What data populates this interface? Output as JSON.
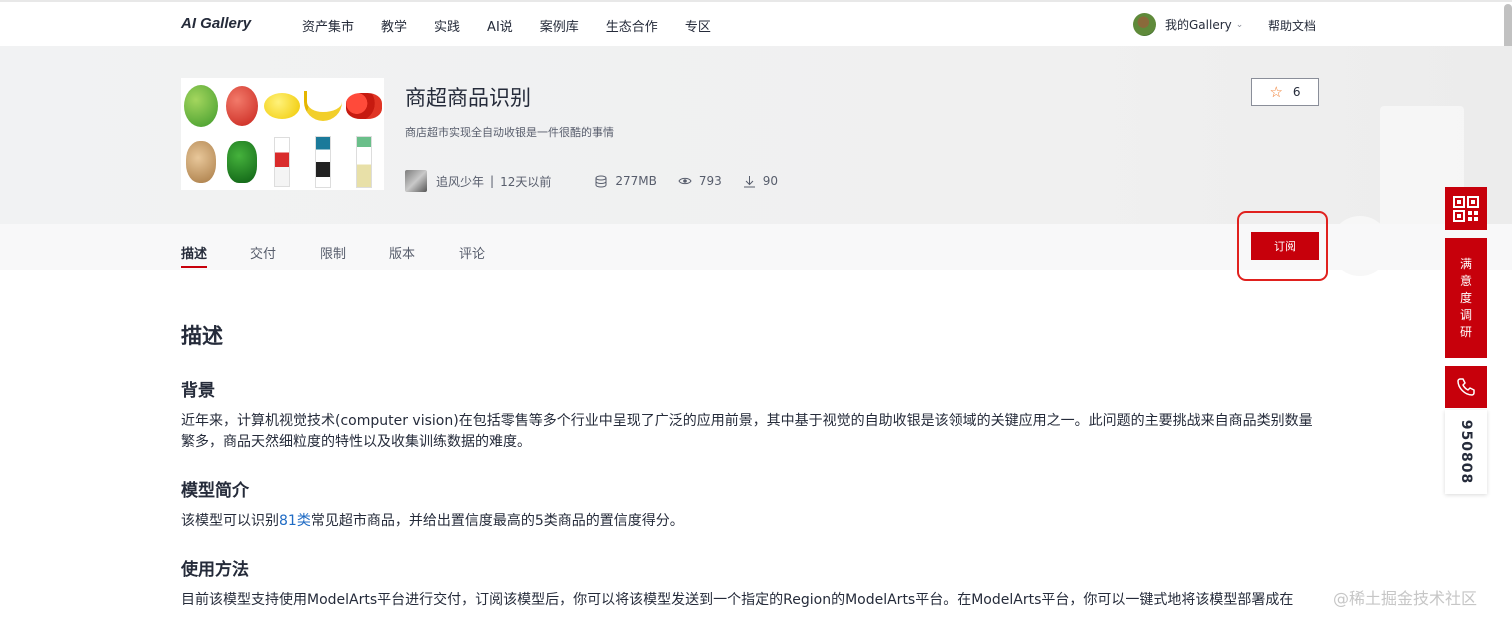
{
  "header": {
    "logo": "AI Gallery",
    "nav": [
      "资产集市",
      "教学",
      "实践",
      "AI说",
      "案例库",
      "生态合作",
      "专区"
    ],
    "user_label": "我的Gallery",
    "help": "帮助文档"
  },
  "asset": {
    "title": "商超商品识别",
    "subtitle": "商店超市实现全自动收银是一件很酷的事情",
    "author": "追风少年",
    "separator": "|",
    "time": "12天以前",
    "size": "277MB",
    "views": "793",
    "downloads": "90",
    "stars": "6"
  },
  "tabs": [
    "描述",
    "交付",
    "限制",
    "版本",
    "评论"
  ],
  "subscribe_label": "订阅",
  "content": {
    "h1": "描述",
    "sections": [
      {
        "heading": "背景",
        "text": "近年来，计算机视觉技术(computer vision)在包括零售等多个行业中呈现了广泛的应用前景，其中基于视觉的自助收银是该领域的关键应用之一。此问题的主要挑战来自商品类别数量繁多，商品天然细粒度的特性以及收集训练数据的难度。"
      },
      {
        "heading": "模型简介",
        "text_before": "该模型可以识别",
        "link": "81类",
        "text_after": "常见超市商品，并给出置信度最高的5类商品的置信度得分。"
      },
      {
        "heading": "使用方法",
        "text": "目前该模型支持使用ModelArts平台进行交付，订阅该模型后，你可以将该模型发送到一个指定的Region的ModelArts平台。在ModelArts平台，你可以一键式地将该模型部署成在"
      }
    ]
  },
  "side": {
    "survey": [
      "满",
      "意",
      "度",
      "调",
      "研"
    ],
    "phone_number": "950808"
  },
  "watermark": "@稀土掘金技术社区",
  "colors": {
    "brand": "#c7000b",
    "link": "#1f6bc4",
    "star": "#f07a2b"
  },
  "icons": [
    "star-icon",
    "database-icon",
    "eye-icon",
    "download-icon",
    "qr-code-icon",
    "phone-icon",
    "chevron-down-icon"
  ]
}
